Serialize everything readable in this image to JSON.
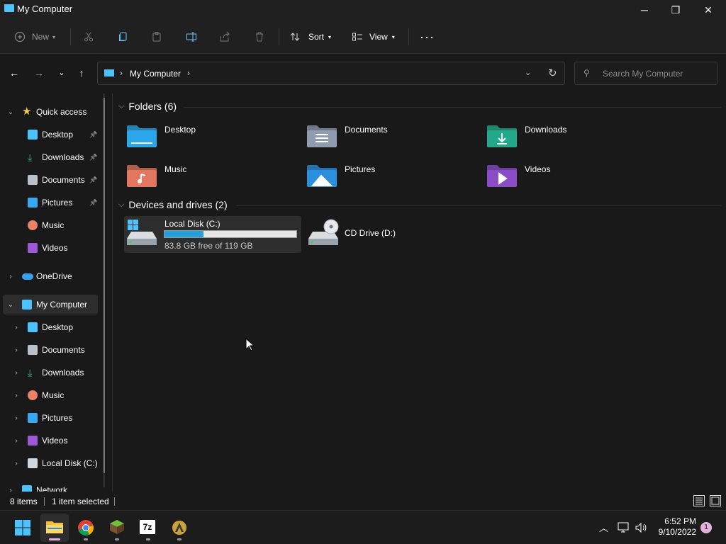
{
  "window": {
    "title": "My Computer",
    "controls": {
      "minimize": "─",
      "maximize": "❐",
      "close": "✕"
    }
  },
  "toolbar": {
    "new_label": "New",
    "sort_label": "Sort",
    "view_label": "View",
    "more_label": "···"
  },
  "address": {
    "crumb": "My Computer",
    "search_placeholder": "Search My Computer"
  },
  "sidebar": {
    "items": [
      {
        "label": "Quick access",
        "icon": "star-icon",
        "color": "#f7c948"
      },
      {
        "label": "Desktop",
        "icon": "desktop-icon",
        "color": "#4cc2ff",
        "pinned": true
      },
      {
        "label": "Downloads",
        "icon": "download-icon",
        "color": "#2fbf8f",
        "pinned": true
      },
      {
        "label": "Documents",
        "icon": "document-icon",
        "color": "#b8c0cc",
        "pinned": true
      },
      {
        "label": "Pictures",
        "icon": "picture-icon",
        "color": "#3aa8f0",
        "pinned": true
      },
      {
        "label": "Music",
        "icon": "music-icon",
        "color": "#e8836a"
      },
      {
        "label": "Videos",
        "icon": "video-icon",
        "color": "#9b59d6"
      },
      {
        "label": "OneDrive",
        "icon": "cloud-icon",
        "color": "#3aa0f0"
      },
      {
        "label": "My Computer",
        "icon": "computer-icon",
        "color": "#4cc2ff",
        "selected": true
      },
      {
        "label": "Desktop",
        "icon": "desktop-icon",
        "color": "#4cc2ff"
      },
      {
        "label": "Documents",
        "icon": "document-icon",
        "color": "#b8c0cc"
      },
      {
        "label": "Downloads",
        "icon": "download-icon",
        "color": "#2fbf8f"
      },
      {
        "label": "Music",
        "icon": "music-icon",
        "color": "#e8836a"
      },
      {
        "label": "Pictures",
        "icon": "picture-icon",
        "color": "#3aa8f0"
      },
      {
        "label": "Videos",
        "icon": "video-icon",
        "color": "#9b59d6"
      },
      {
        "label": "Local Disk (C:)",
        "icon": "drive-icon",
        "color": "#cfd8e0"
      },
      {
        "label": "Network",
        "icon": "network-icon",
        "color": "#4cc2ff"
      }
    ]
  },
  "folders": {
    "header": "Folders (6)",
    "items": [
      {
        "label": "Desktop",
        "icon": "desktop-folder-icon",
        "color": "#2aa7e8"
      },
      {
        "label": "Documents",
        "icon": "documents-folder-icon",
        "color": "#8f9bb0"
      },
      {
        "label": "Downloads",
        "icon": "downloads-folder-icon",
        "color": "#22a98a"
      },
      {
        "label": "Music",
        "icon": "music-folder-icon",
        "color": "#e0775e"
      },
      {
        "label": "Pictures",
        "icon": "pictures-folder-icon",
        "color": "#2b8fe0"
      },
      {
        "label": "Videos",
        "icon": "videos-folder-icon",
        "color": "#8b4cc8"
      }
    ]
  },
  "drives": {
    "header": "Devices and drives (2)",
    "items": [
      {
        "label": "Local Disk (C:)",
        "free_text": "83.8 GB free of 119 GB",
        "used_fraction": 0.296,
        "selected": true,
        "icon": "hard-drive-icon"
      },
      {
        "label": "CD Drive (D:)",
        "icon": "cd-drive-icon"
      }
    ]
  },
  "status": {
    "items_count": "8 items",
    "selection": "1 item selected"
  },
  "taskbar": {
    "apps": [
      {
        "name": "start-icon"
      },
      {
        "name": "file-explorer-icon",
        "active": true
      },
      {
        "name": "chrome-icon"
      },
      {
        "name": "minecraft-icon"
      },
      {
        "name": "7zip-icon",
        "text": "7z"
      },
      {
        "name": "app-icon"
      }
    ],
    "time": "6:52 PM",
    "date": "9/10/2022",
    "notifications": "1"
  }
}
